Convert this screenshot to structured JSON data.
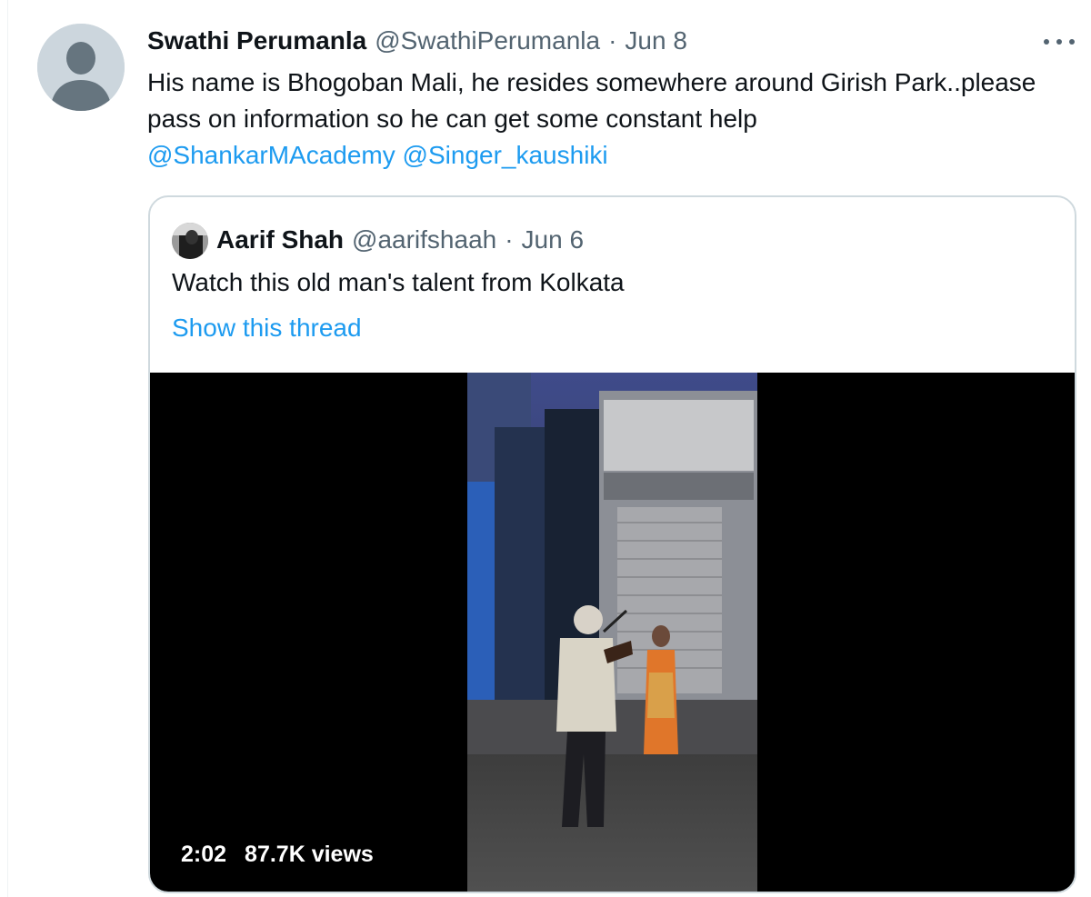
{
  "tweet": {
    "author_name": "Swathi Perumanla",
    "author_handle": "@SwathiPerumanla",
    "separator": "·",
    "date": "Jun 8",
    "text": "His name is Bhogoban Mali, he resides somewhere around Girish Park..please pass on information so he can get some constant help",
    "mentions": [
      "@ShankarMAcademy",
      "@Singer_kaushiki"
    ],
    "more_icon": "more-horizontal-icon",
    "avatar_icon": "default-profile-icon"
  },
  "quoted_tweet": {
    "author_name": "Aarif Shah",
    "author_handle": "@aarifshaah",
    "separator": "·",
    "date": "Jun 6",
    "text": "Watch this old man's talent from Kolkata",
    "show_thread": "Show this thread",
    "video": {
      "duration": "2:02",
      "views": "87.7K views"
    }
  },
  "colors": {
    "link": "#1d9bf0",
    "muted": "#536471",
    "text": "#0f1419",
    "border": "#cfd9de"
  }
}
